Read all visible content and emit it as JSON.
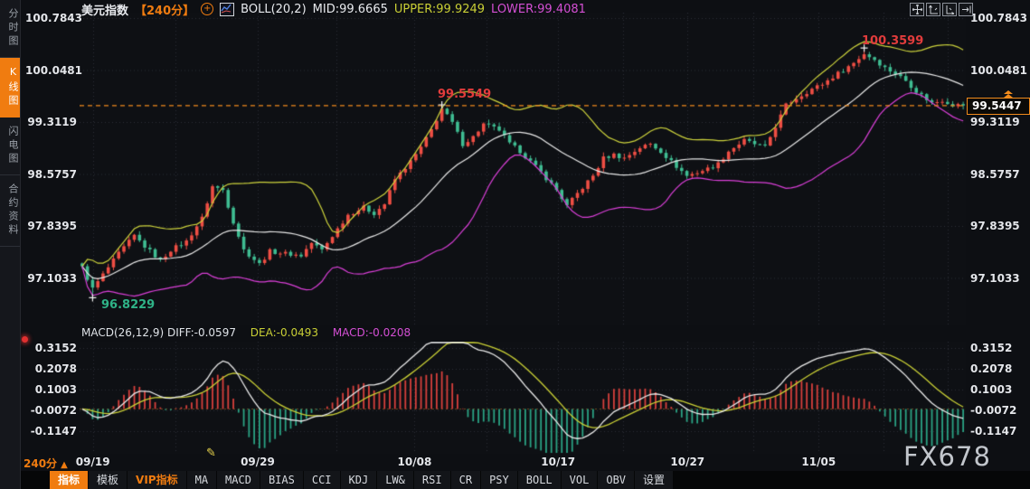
{
  "header": {
    "symbol": "美元指数",
    "period": "【240分】",
    "plus_icon": "+",
    "boll_label": "BOLL(20,2)",
    "mid": "MID:99.6665",
    "upper": "UPPER:99.9249",
    "lower": "LOWER:99.4081"
  },
  "sidebar": {
    "items": [
      {
        "label": "分时图",
        "active": false
      },
      {
        "label": "K线图",
        "active": true
      },
      {
        "label": "闪电图",
        "active": false
      },
      {
        "label": "合约资料",
        "active": false
      }
    ]
  },
  "macd_header": {
    "name_diff": "MACD(26,12,9) DIFF:-0.0597",
    "dea": "DEA:-0.0493",
    "macd": "MACD:-0.0208"
  },
  "annotations": {
    "high1": "99.5549",
    "high2": "100.3599",
    "low1": "96.8229",
    "last_price": "99.5447"
  },
  "footer": {
    "period": "240分",
    "period_arrow": "▲",
    "buttons": [
      {
        "label": "指标",
        "style": "active cn"
      },
      {
        "label": "模板",
        "style": "cn"
      },
      {
        "label": "VIP指标",
        "style": "vip cn"
      },
      {
        "label": "MA",
        "style": ""
      },
      {
        "label": "MACD",
        "style": ""
      },
      {
        "label": "BIAS",
        "style": ""
      },
      {
        "label": "CCI",
        "style": ""
      },
      {
        "label": "KDJ",
        "style": ""
      },
      {
        "label": "LW&",
        "style": ""
      },
      {
        "label": "RSI",
        "style": ""
      },
      {
        "label": "CR",
        "style": ""
      },
      {
        "label": "PSY",
        "style": ""
      },
      {
        "label": "BOLL",
        "style": ""
      },
      {
        "label": "VOL",
        "style": ""
      },
      {
        "label": "OBV",
        "style": ""
      },
      {
        "label": "设置",
        "style": "cn"
      }
    ]
  },
  "watermark": "FX678",
  "colors": {
    "accent": "#f07c10",
    "up": "#ef4e44",
    "down": "#3fbd92",
    "boll_upper": "#cdd33c",
    "boll_mid": "#e9e9e9",
    "boll_lower": "#da3fd8",
    "hist_up": "#d8403c",
    "hist_down": "#2aa384",
    "diff_line": "#e9e9e9",
    "dea_line": "#c9cf35",
    "grid": "#2b2e35",
    "last_price_line": "#f18a1d",
    "ann_red": "#e23c3c",
    "ann_green": "#2fb387"
  },
  "chart_data": {
    "type": "candlestick",
    "title": "美元指数 240分 K线图 + BOLL(20,2) + MACD(26,12,9)",
    "candle_count": 170,
    "y_axis_ticks": [
      100.7843,
      100.0481,
      99.3119,
      98.5757,
      97.8395,
      97.1033
    ],
    "price_path_anchors": [
      [
        0,
        97.25
      ],
      [
        2,
        96.95
      ],
      [
        4,
        97.15
      ],
      [
        7,
        97.45
      ],
      [
        10,
        97.7
      ],
      [
        12,
        97.55
      ],
      [
        15,
        97.35
      ],
      [
        17,
        97.5
      ],
      [
        20,
        97.62
      ],
      [
        23,
        97.95
      ],
      [
        25,
        98.4
      ],
      [
        27,
        98.35
      ],
      [
        29,
        97.9
      ],
      [
        31,
        97.5
      ],
      [
        34,
        97.3
      ],
      [
        36,
        97.48
      ],
      [
        39,
        97.45
      ],
      [
        42,
        97.42
      ],
      [
        44,
        97.6
      ],
      [
        46,
        97.5
      ],
      [
        49,
        97.8
      ],
      [
        51,
        98.0
      ],
      [
        54,
        98.1
      ],
      [
        56,
        98.02
      ],
      [
        58,
        98.15
      ],
      [
        60,
        98.5
      ],
      [
        63,
        98.75
      ],
      [
        65,
        98.95
      ],
      [
        67,
        99.2
      ],
      [
        69,
        99.5
      ],
      [
        71,
        99.3
      ],
      [
        73,
        99.0
      ],
      [
        75,
        99.1
      ],
      [
        77,
        99.28
      ],
      [
        80,
        99.2
      ],
      [
        82,
        99.0
      ],
      [
        84,
        98.9
      ],
      [
        86,
        98.75
      ],
      [
        88,
        98.6
      ],
      [
        91,
        98.35
      ],
      [
        93,
        98.12
      ],
      [
        95,
        98.3
      ],
      [
        98,
        98.55
      ],
      [
        100,
        98.8
      ],
      [
        102,
        98.85
      ],
      [
        104,
        98.8
      ],
      [
        107,
        98.95
      ],
      [
        109,
        99.0
      ],
      [
        111,
        98.9
      ],
      [
        113,
        98.75
      ],
      [
        116,
        98.55
      ],
      [
        118,
        98.6
      ],
      [
        120,
        98.65
      ],
      [
        122,
        98.72
      ],
      [
        124,
        98.9
      ],
      [
        127,
        99.05
      ],
      [
        129,
        99.0
      ],
      [
        131,
        98.95
      ],
      [
        133,
        99.25
      ],
      [
        135,
        99.55
      ],
      [
        137,
        99.65
      ],
      [
        140,
        99.78
      ],
      [
        142,
        99.85
      ],
      [
        144,
        99.95
      ],
      [
        146,
        100.05
      ],
      [
        148,
        100.15
      ],
      [
        150,
        100.28
      ],
      [
        152,
        100.2
      ],
      [
        154,
        100.08
      ],
      [
        156,
        100.0
      ],
      [
        158,
        99.9
      ],
      [
        160,
        99.75
      ],
      [
        163,
        99.58
      ],
      [
        165,
        99.62
      ],
      [
        167,
        99.56
      ],
      [
        169,
        99.5447
      ]
    ],
    "marked_points": {
      "low": {
        "index": 2,
        "price": 96.8229
      },
      "high1": {
        "index": 69,
        "price": 99.5549
      },
      "high2": {
        "index": 150,
        "price": 100.3599
      }
    },
    "last_close": 99.5447,
    "boll": {
      "period": 20,
      "k": 2,
      "mid": 99.6665,
      "upper": 99.9249,
      "lower": 99.4081
    },
    "macd": {
      "fast": 12,
      "slow": 26,
      "signal": 9,
      "diff": -0.0597,
      "dea": -0.0493,
      "macd": -0.0208,
      "axis_ticks": [
        0.3152,
        0.2078,
        0.1003,
        -0.0072,
        -0.1147
      ]
    },
    "x_dates": [
      {
        "label": "09/19",
        "frac": 0.015
      },
      {
        "label": "09/29",
        "frac": 0.201
      },
      {
        "label": "10/08",
        "frac": 0.378
      },
      {
        "label": "10/17",
        "frac": 0.54
      },
      {
        "label": "10/27",
        "frac": 0.686
      },
      {
        "label": "11/05",
        "frac": 0.834
      }
    ],
    "grid_fracs": [
      0.015,
      0.108,
      0.201,
      0.29,
      0.378,
      0.459,
      0.54,
      0.613,
      0.686,
      0.76,
      0.834,
      0.907,
      0.98
    ]
  }
}
